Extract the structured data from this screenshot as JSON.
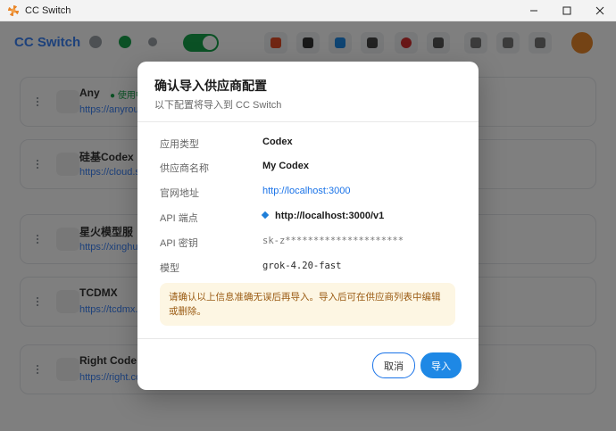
{
  "window": {
    "title": "CC Switch",
    "controls": [
      "minimize-icon",
      "maximize-icon",
      "close-icon"
    ]
  },
  "app": {
    "brand": "CC Switch",
    "providers": [
      {
        "name": "Any",
        "badge": "● 使用中",
        "url": "https://anyrouter.top"
      },
      {
        "name": "硅基Codex",
        "url": "https://cloud.siliconflow.cn"
      },
      {
        "name": "星火模型服",
        "url": "https://xinghuo.xfyun.cn"
      },
      {
        "name": "TCDMX",
        "url": "https://tcdmx.com"
      },
      {
        "name": "Right Code",
        "url": "https://right.codes"
      }
    ]
  },
  "dialog": {
    "title": "确认导入供应商配置",
    "subtitle": "以下配置将导入到 CC Switch",
    "fields": [
      {
        "label": "应用类型",
        "value": "Codex"
      },
      {
        "label": "供应商名称",
        "value": "My Codex"
      },
      {
        "label": "官网地址",
        "value": "http://localhost:3000"
      },
      {
        "label": "API 端点",
        "value": "http://localhost:3000/v1"
      },
      {
        "label": "API 密钥",
        "value": "sk-z*********************"
      },
      {
        "label": "模型",
        "value": "grok-4.20-fast"
      }
    ],
    "warning": "请确认以上信息准确无误后再导入。导入后可在供应商列表中编辑或删除。",
    "cancel_label": "取消",
    "import_label": "导入"
  },
  "colors": {
    "primary": "#1e88e5",
    "link": "#1a73e8",
    "warning_bg": "#fdf6e3",
    "warning_text": "#9a5b13"
  }
}
